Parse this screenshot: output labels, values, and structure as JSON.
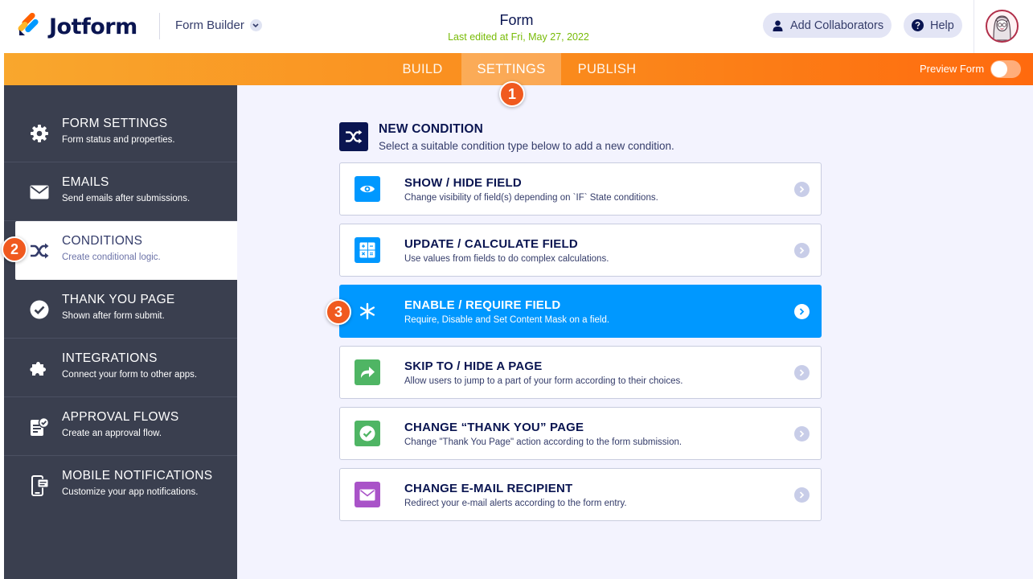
{
  "header": {
    "logo_text": "Jotform",
    "builder_label": "Form Builder",
    "form_title": "Form",
    "last_edited": "Last edited at Fri, May 27, 2022",
    "collaborators_label": "Add Collaborators",
    "help_label": "Help"
  },
  "nav": {
    "tabs": [
      {
        "label": "BUILD"
      },
      {
        "label": "SETTINGS"
      },
      {
        "label": "PUBLISH"
      }
    ],
    "active_tab": "SETTINGS",
    "preview_label": "Preview Form",
    "preview_on": false
  },
  "badges": [
    "1",
    "2",
    "3"
  ],
  "sidebar": {
    "items": [
      {
        "title": "FORM SETTINGS",
        "desc": "Form status and properties.",
        "icon": "gear-icon"
      },
      {
        "title": "EMAILS",
        "desc": "Send emails after submissions.",
        "icon": "envelope-icon"
      },
      {
        "title": "CONDITIONS",
        "desc": "Create conditional logic.",
        "icon": "shuffle-icon"
      },
      {
        "title": "THANK YOU PAGE",
        "desc": "Shown after form submit.",
        "icon": "check-circle-icon"
      },
      {
        "title": "INTEGRATIONS",
        "desc": "Connect your form to other apps.",
        "icon": "puzzle-icon"
      },
      {
        "title": "APPROVAL FLOWS",
        "desc": "Create an approval flow.",
        "icon": "approval-icon"
      },
      {
        "title": "MOBILE NOTIFICATIONS",
        "desc": "Customize your app notifications.",
        "icon": "mobile-icon"
      }
    ],
    "active_item": "CONDITIONS"
  },
  "main": {
    "title": "NEW CONDITION",
    "desc": "Select a suitable condition type below to add a new condition.",
    "options": [
      {
        "title": "SHOW / HIDE FIELD",
        "desc": "Change visibility of field(s) depending on `IF` State conditions.",
        "icon": "eye-icon",
        "color": "#0098ff"
      },
      {
        "title": "UPDATE / CALCULATE FIELD",
        "desc": "Use values from fields to do complex calculations.",
        "icon": "calculator-icon",
        "color": "#0098ff"
      },
      {
        "title": "ENABLE / REQUIRE FIELD",
        "desc": "Require, Disable and Set Content Mask on a field.",
        "icon": "asterisk-icon",
        "color": "#0098ff"
      },
      {
        "title": "SKIP TO / HIDE A PAGE",
        "desc": "Allow users to jump to a part of your form according to their choices.",
        "icon": "skip-arrow-icon",
        "color": "#4fb564"
      },
      {
        "title": "CHANGE “THANK YOU” PAGE",
        "desc": "Change \"Thank You Page\" action according to the form submission.",
        "icon": "check-circle-icon",
        "color": "#4fb564"
      },
      {
        "title": "CHANGE E-MAIL RECIPIENT",
        "desc": "Redirect your e-mail alerts according to the form entry.",
        "icon": "envelope-icon",
        "color": "#a953c8"
      }
    ],
    "active_option": "ENABLE / REQUIRE FIELD"
  },
  "colors": {
    "brand_navy": "#0a1551",
    "accent_blue": "#0098ff",
    "orange": "#fa8a1c",
    "sidebar_bg": "#3a3f4f",
    "green": "#4fb564",
    "purple": "#a953c8",
    "badge": "#f05a1f"
  }
}
